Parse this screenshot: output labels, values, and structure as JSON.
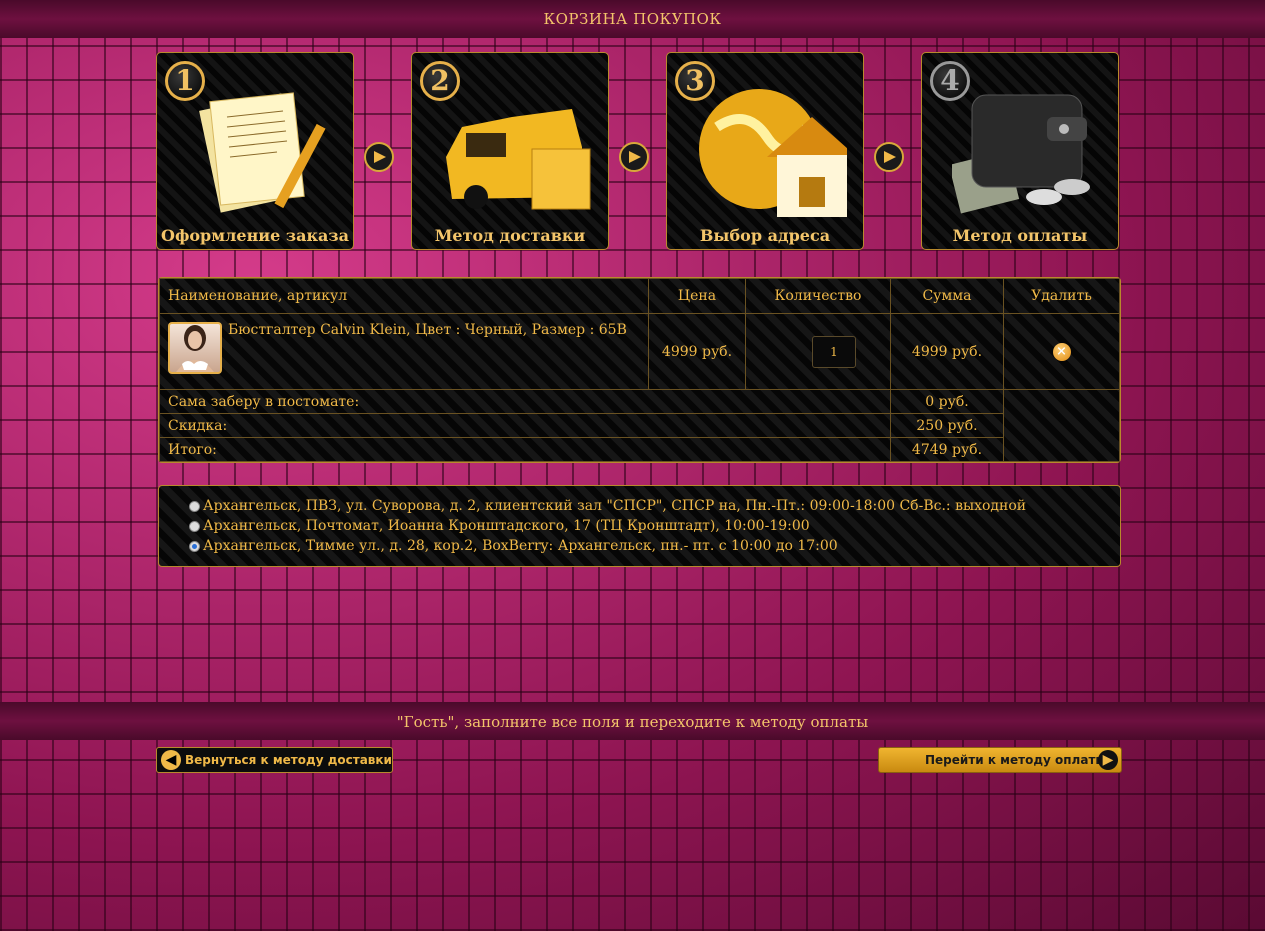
{
  "header": {
    "title": "КОРЗИНА ПОКУПОК"
  },
  "steps": [
    {
      "num": "1",
      "title": "Оформление заказа",
      "icon": "document-pen-icon"
    },
    {
      "num": "2",
      "title": "Метод доставки",
      "icon": "delivery-van-icon"
    },
    {
      "num": "3",
      "title": "Выбор адреса",
      "icon": "globe-house-icon"
    },
    {
      "num": "4",
      "title": "Метод оплаты",
      "icon": "wallet-icon"
    }
  ],
  "cart": {
    "columns": {
      "name": "Наименование, артикул",
      "price": "Цена",
      "qty": "Количество",
      "sum": "Сумма",
      "delete": "Удалить"
    },
    "item": {
      "name": "Бюстгалтер Calvin Klein, Цвет : Черный, Размер : 65B",
      "price": "4999 руб.",
      "qty": "1",
      "sum": "4999 руб."
    },
    "summary": [
      {
        "label": "Сама заберу в постомате:",
        "value": "0 руб."
      },
      {
        "label": "Скидка:",
        "value": "250 руб."
      },
      {
        "label": "Итого:",
        "value": "4749 руб."
      }
    ]
  },
  "addresses": [
    {
      "label": "Архангельск, ПВЗ, ул. Суворова, д. 2, клиентский зал \"СПСР\", СПСР на, Пн.-Пт.: 09:00-18:00 Сб-Вс.: выходной",
      "checked": false
    },
    {
      "label": "Архангельск, Почтомат, Иоанна Кронштадского, 17 (ТЦ Кронштадт), 10:00-19:00",
      "checked": false
    },
    {
      "label": "Архангельск, Тимме ул., д. 28, кор.2, BoxBerry: Архангельск, пн.- пт. с 10:00 до 17:00",
      "checked": true
    }
  ],
  "footer": {
    "message": "\"Гость\", заполните все поля и переходите к методу оплаты",
    "back_label": "Вернуться к методу доставки",
    "next_label": "Перейти к методу оплаты"
  },
  "colors": {
    "gold": "#f0b948",
    "background": "#9a1a5c",
    "panel": "#0a0a0a"
  }
}
